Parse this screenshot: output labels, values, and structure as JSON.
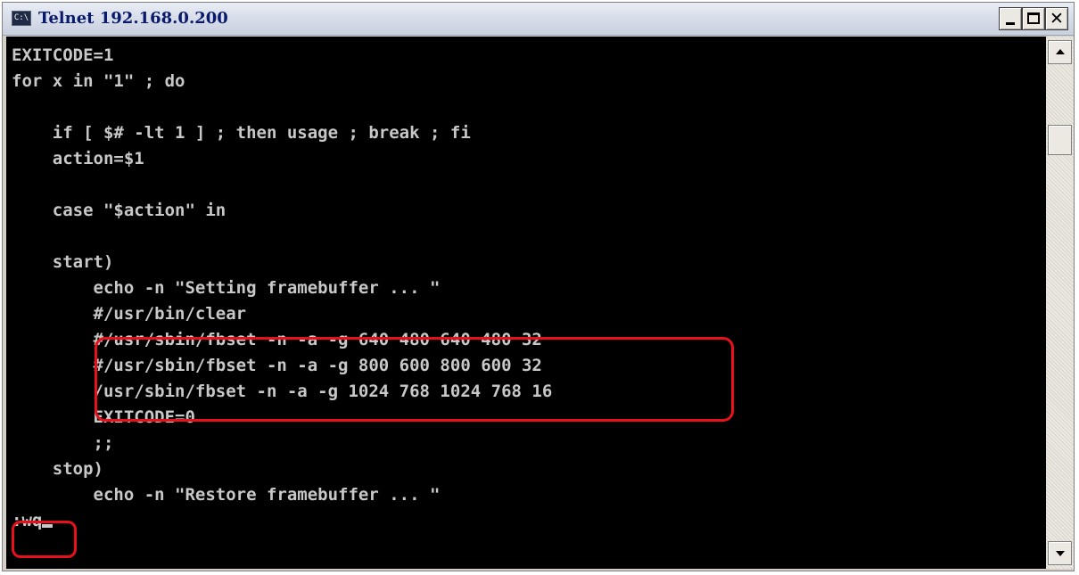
{
  "window": {
    "title": "Telnet 192.168.0.200",
    "icon": "console-icon",
    "icon_text": "C:\\",
    "buttons": {
      "minimize": "minimize-icon",
      "maximize": "maximize-icon",
      "close": "close-icon",
      "close_glyph": "✕"
    }
  },
  "terminal": {
    "lines": [
      "EXITCODE=1",
      "for x in \"1\" ; do",
      "",
      "    if [ $# -lt 1 ] ; then usage ; break ; fi",
      "    action=$1",
      "",
      "    case \"$action\" in",
      "",
      "    start)",
      "        echo -n \"Setting framebuffer ... \"",
      "        #/usr/bin/clear",
      "        #/usr/sbin/fbset -n -a -g 640 480 640 480 32",
      "        #/usr/sbin/fbset -n -a -g 800 600 800 600 32",
      "        /usr/sbin/fbset -n -a -g 1024 768 1024 768 16",
      "        EXITCODE=0",
      "        ;;",
      "    stop)",
      "        echo -n \"Restore framebuffer ... \""
    ],
    "command": ":wq"
  },
  "scrollbar": {
    "up": "arrow-up-icon",
    "down": "arrow-down-icon"
  },
  "annotations": {
    "color": "#e8101a"
  },
  "colors": {
    "terminal_bg": "#000000",
    "terminal_fg": "#c8c8c8",
    "title_fg": "#0a1a6a"
  }
}
